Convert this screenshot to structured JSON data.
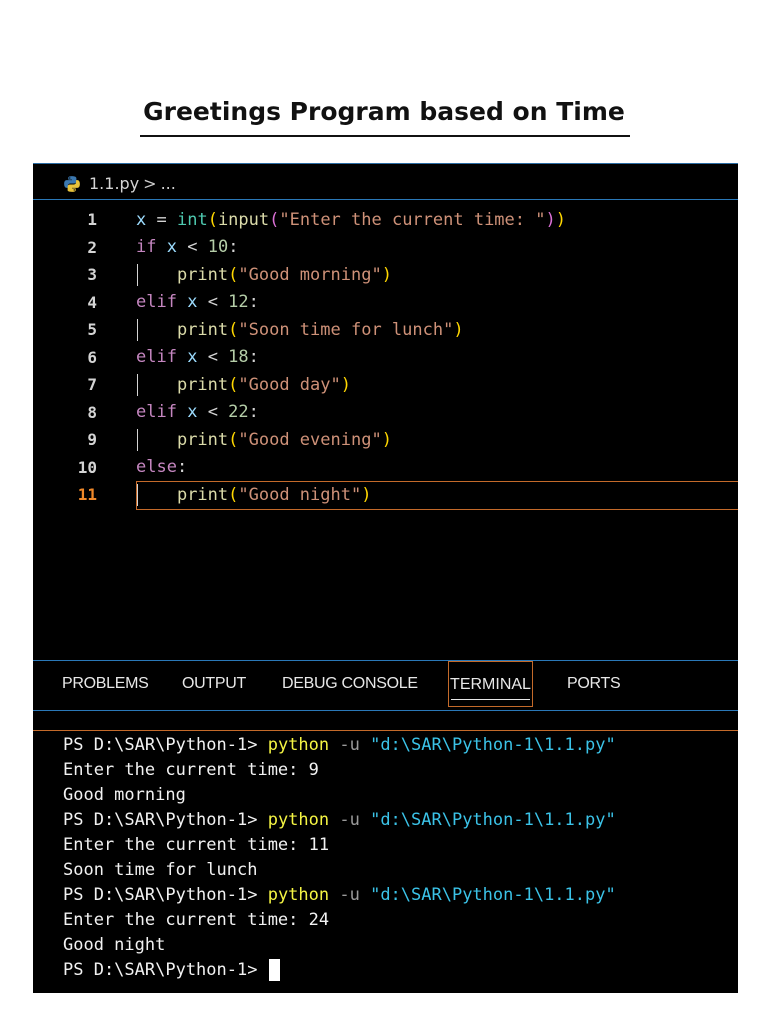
{
  "page": {
    "title": "Greetings Program based on Time"
  },
  "breadcrumb": {
    "file": "1.1.py",
    "separator": ">",
    "more": "..."
  },
  "editor": {
    "active_line": 11,
    "lines": [
      {
        "n": "1",
        "indent": false,
        "tokens": [
          [
            "var",
            "x"
          ],
          [
            "op",
            " = "
          ],
          [
            "bi",
            "int"
          ],
          [
            "p1",
            "("
          ],
          [
            "fn",
            "input"
          ],
          [
            "p2",
            "("
          ],
          [
            "str",
            "\"Enter the current time: \""
          ],
          [
            "p2",
            ")"
          ],
          [
            "p1",
            ")"
          ]
        ]
      },
      {
        "n": "2",
        "indent": false,
        "tokens": [
          [
            "kw",
            "if"
          ],
          [
            "op",
            " "
          ],
          [
            "var",
            "x"
          ],
          [
            "op",
            " < "
          ],
          [
            "num",
            "10"
          ],
          [
            "op",
            ":"
          ]
        ]
      },
      {
        "n": "3",
        "indent": true,
        "tokens": [
          [
            "fn",
            "print"
          ],
          [
            "p1",
            "("
          ],
          [
            "str",
            "\"Good morning\""
          ],
          [
            "p1",
            ")"
          ]
        ]
      },
      {
        "n": "4",
        "indent": false,
        "tokens": [
          [
            "kw",
            "elif"
          ],
          [
            "op",
            " "
          ],
          [
            "var",
            "x"
          ],
          [
            "op",
            " < "
          ],
          [
            "num",
            "12"
          ],
          [
            "op",
            ":"
          ]
        ]
      },
      {
        "n": "5",
        "indent": true,
        "tokens": [
          [
            "fn",
            "print"
          ],
          [
            "p1",
            "("
          ],
          [
            "str",
            "\"Soon time for lunch\""
          ],
          [
            "p1",
            ")"
          ]
        ]
      },
      {
        "n": "6",
        "indent": false,
        "tokens": [
          [
            "kw",
            "elif"
          ],
          [
            "op",
            " "
          ],
          [
            "var",
            "x"
          ],
          [
            "op",
            " < "
          ],
          [
            "num",
            "18"
          ],
          [
            "op",
            ":"
          ]
        ]
      },
      {
        "n": "7",
        "indent": true,
        "tokens": [
          [
            "fn",
            "print"
          ],
          [
            "p1",
            "("
          ],
          [
            "str",
            "\"Good day\""
          ],
          [
            "p1",
            ")"
          ]
        ]
      },
      {
        "n": "8",
        "indent": false,
        "tokens": [
          [
            "kw",
            "elif"
          ],
          [
            "op",
            " "
          ],
          [
            "var",
            "x"
          ],
          [
            "op",
            " < "
          ],
          [
            "num",
            "22"
          ],
          [
            "op",
            ":"
          ]
        ]
      },
      {
        "n": "9",
        "indent": true,
        "tokens": [
          [
            "fn",
            "print"
          ],
          [
            "p1",
            "("
          ],
          [
            "str",
            "\"Good evening\""
          ],
          [
            "p1",
            ")"
          ]
        ]
      },
      {
        "n": "10",
        "indent": false,
        "tokens": [
          [
            "kw",
            "else"
          ],
          [
            "op",
            ":"
          ]
        ]
      },
      {
        "n": "11",
        "indent": true,
        "tokens": [
          [
            "fn",
            "print"
          ],
          [
            "p1",
            "("
          ],
          [
            "str",
            "\"Good night\""
          ],
          [
            "p1",
            ")"
          ]
        ]
      }
    ]
  },
  "panel": {
    "tabs": [
      "PROBLEMS",
      "OUTPUT",
      "DEBUG CONSOLE",
      "TERMINAL",
      "PORTS"
    ],
    "active_tab": "TERMINAL"
  },
  "terminal": {
    "lines": [
      {
        "kind": "cmd",
        "prompt": "PS D:\\SAR\\Python-1> ",
        "cmd": "python",
        "flag": " -u ",
        "path": "\"d:\\SAR\\Python-1\\1.1.py\""
      },
      {
        "kind": "out",
        "text": "Enter the current time: 9"
      },
      {
        "kind": "out",
        "text": "Good morning"
      },
      {
        "kind": "cmd",
        "prompt": "PS D:\\SAR\\Python-1> ",
        "cmd": "python",
        "flag": " -u ",
        "path": "\"d:\\SAR\\Python-1\\1.1.py\""
      },
      {
        "kind": "out",
        "text": "Enter the current time: 11"
      },
      {
        "kind": "out",
        "text": "Soon time for lunch"
      },
      {
        "kind": "cmd",
        "prompt": "PS D:\\SAR\\Python-1> ",
        "cmd": "python",
        "flag": " -u ",
        "path": "\"d:\\SAR\\Python-1\\1.1.py\""
      },
      {
        "kind": "out",
        "text": "Enter the current time: 24"
      },
      {
        "kind": "out",
        "text": "Good night"
      },
      {
        "kind": "prompt",
        "prompt": "PS D:\\SAR\\Python-1>"
      }
    ]
  },
  "colors": {
    "accent_orange": "#c46a2a",
    "accent_blue": "#2a78b8",
    "background": "#000000"
  },
  "icons": {
    "file_icon": "python-icon",
    "cursor": "terminal-cursor"
  }
}
